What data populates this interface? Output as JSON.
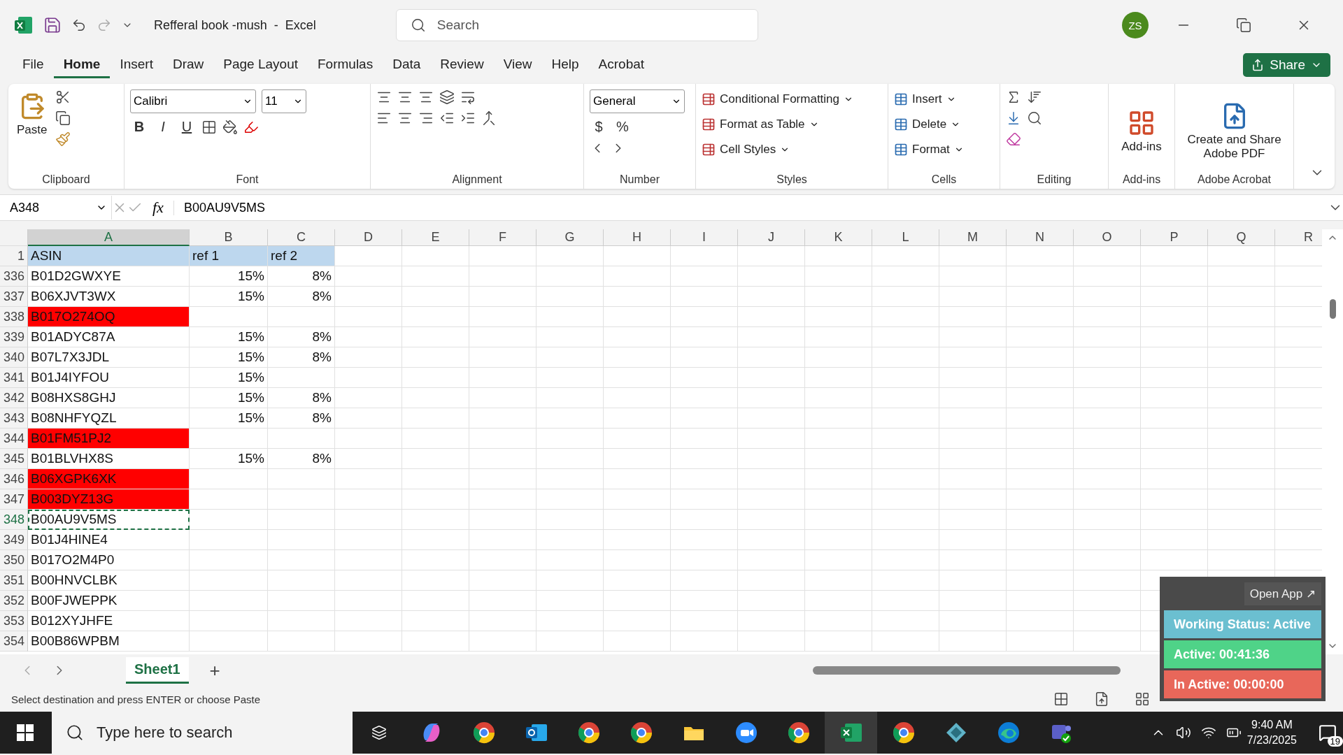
{
  "window": {
    "title": "Refferal book -mush  -  Excel",
    "search_placeholder": "Search",
    "user_initials": "ZS"
  },
  "ribbon_tabs": [
    {
      "label": "File",
      "selected": false
    },
    {
      "label": "Home",
      "selected": true
    },
    {
      "label": "Insert",
      "selected": false
    },
    {
      "label": "Draw",
      "selected": false
    },
    {
      "label": "Page Layout",
      "selected": false
    },
    {
      "label": "Formulas",
      "selected": false
    },
    {
      "label": "Data",
      "selected": false
    },
    {
      "label": "Review",
      "selected": false
    },
    {
      "label": "View",
      "selected": false
    },
    {
      "label": "Help",
      "selected": false
    },
    {
      "label": "Acrobat",
      "selected": false
    }
  ],
  "share_button": "Share",
  "ribbon": {
    "clipboard": {
      "paste": "Paste",
      "group": "Clipboard"
    },
    "font": {
      "name": "Calibri",
      "size": "11",
      "bold": "B",
      "italic": "I",
      "underline": "U",
      "group": "Font"
    },
    "alignment": {
      "group": "Alignment"
    },
    "number": {
      "format": "General",
      "currency": "$",
      "percent": "%",
      "group": "Number"
    },
    "styles": {
      "items": [
        "Conditional Formatting",
        "Format as Table",
        "Cell Styles"
      ],
      "group": "Styles"
    },
    "cells": {
      "items": [
        "Insert",
        "Delete",
        "Format"
      ],
      "group": "Cells"
    },
    "editing": {
      "group": "Editing"
    },
    "addins": {
      "label": "Add-ins",
      "group": "Add-ins"
    },
    "acrobat": {
      "label": "Create and Share Adobe PDF",
      "group": "Adobe Acrobat"
    }
  },
  "formula_bar": {
    "name_box": "A348",
    "fx": "fx",
    "value": "B00AU9V5MS"
  },
  "sheet": {
    "columns": [
      {
        "label": "A",
        "selected": true
      },
      {
        "label": "B",
        "selected": false
      },
      {
        "label": "C",
        "selected": false
      },
      {
        "label": "D",
        "selected": false
      },
      {
        "label": "E",
        "selected": false
      },
      {
        "label": "F",
        "selected": false
      },
      {
        "label": "G",
        "selected": false
      },
      {
        "label": "H",
        "selected": false
      },
      {
        "label": "I",
        "selected": false
      },
      {
        "label": "J",
        "selected": false
      },
      {
        "label": "K",
        "selected": false
      },
      {
        "label": "L",
        "selected": false
      },
      {
        "label": "M",
        "selected": false
      },
      {
        "label": "N",
        "selected": false
      },
      {
        "label": "O",
        "selected": false
      },
      {
        "label": "P",
        "selected": false
      },
      {
        "label": "Q",
        "selected": false
      },
      {
        "label": "R",
        "selected": false
      }
    ],
    "rows": [
      {
        "number": "1",
        "kind": "header",
        "cells": [
          "ASIN",
          "ref 1",
          "ref 2"
        ],
        "highlight": false,
        "selected": false
      },
      {
        "number": "336",
        "kind": "data",
        "cells": [
          "B01D2GWXYE",
          "15%",
          "8%"
        ],
        "highlight": false,
        "selected": false
      },
      {
        "number": "337",
        "kind": "data",
        "cells": [
          "B06XJVT3WX",
          "15%",
          "8%"
        ],
        "highlight": false,
        "selected": false
      },
      {
        "number": "338",
        "kind": "data",
        "cells": [
          "B017O274OQ"
        ],
        "highlight": true,
        "selected": false
      },
      {
        "number": "339",
        "kind": "data",
        "cells": [
          "B01ADYC87A",
          "15%",
          "8%"
        ],
        "highlight": false,
        "selected": false
      },
      {
        "number": "340",
        "kind": "data",
        "cells": [
          "B07L7X3JDL",
          "15%",
          "8%"
        ],
        "highlight": false,
        "selected": false
      },
      {
        "number": "341",
        "kind": "data",
        "cells": [
          "B01J4IYFOU",
          "15%"
        ],
        "highlight": false,
        "selected": false
      },
      {
        "number": "342",
        "kind": "data",
        "cells": [
          "B08HXS8GHJ",
          "15%",
          "8%"
        ],
        "highlight": false,
        "selected": false
      },
      {
        "number": "343",
        "kind": "data",
        "cells": [
          "B08NHFYQZL",
          "15%",
          "8%"
        ],
        "highlight": false,
        "selected": false
      },
      {
        "number": "344",
        "kind": "data",
        "cells": [
          "B01FM51PJ2"
        ],
        "highlight": true,
        "selected": false
      },
      {
        "number": "345",
        "kind": "data",
        "cells": [
          "B01BLVHX8S",
          "15%",
          "8%"
        ],
        "highlight": false,
        "selected": false
      },
      {
        "number": "346",
        "kind": "data",
        "cells": [
          "B06XGPK6XK"
        ],
        "highlight": true,
        "selected": false
      },
      {
        "number": "347",
        "kind": "data",
        "cells": [
          "B003DYZ13G"
        ],
        "highlight": true,
        "selected": false
      },
      {
        "number": "348",
        "kind": "data",
        "cells": [
          "B00AU9V5MS"
        ],
        "highlight": false,
        "selected": true
      },
      {
        "number": "349",
        "kind": "data",
        "cells": [
          "B01J4HINE4"
        ],
        "highlight": false,
        "selected": false
      },
      {
        "number": "350",
        "kind": "data",
        "cells": [
          "B017O2M4P0"
        ],
        "highlight": false,
        "selected": false
      },
      {
        "number": "351",
        "kind": "data",
        "cells": [
          "B00HNVCLBK"
        ],
        "highlight": false,
        "selected": false
      },
      {
        "number": "352",
        "kind": "data",
        "cells": [
          "B00FJWEPPK"
        ],
        "highlight": false,
        "selected": false
      },
      {
        "number": "353",
        "kind": "data",
        "cells": [
          "B012XYJHFE"
        ],
        "highlight": false,
        "selected": false
      },
      {
        "number": "354",
        "kind": "data",
        "cells": [
          "B00B86WPBM"
        ],
        "highlight": false,
        "selected": false
      }
    ]
  },
  "sheet_tabs": [
    {
      "label": "Sheet1",
      "selected": true
    }
  ],
  "add_sheet": "+",
  "status_bar": {
    "message": "Select destination and press ENTER or choose Paste"
  },
  "tracker_widget": {
    "open_app": "Open App ↗",
    "bars": [
      {
        "label": "Working Status: Active",
        "color": "#6bbfd0"
      },
      {
        "label": "Active: 00:41:36",
        "color": "#4fd388"
      },
      {
        "label": "In Active: 00:00:00",
        "color": "#e8675a"
      }
    ]
  },
  "taskbar": {
    "search_placeholder": "Type here to search",
    "apps": [
      {
        "kind": "copilot",
        "active": false
      },
      {
        "kind": "chrome",
        "active": false
      },
      {
        "kind": "outlook",
        "active": false
      },
      {
        "kind": "chrome",
        "active": false
      },
      {
        "kind": "chrome",
        "active": false
      },
      {
        "kind": "folder",
        "active": false
      },
      {
        "kind": "zoom",
        "active": false
      },
      {
        "kind": "chrome",
        "active": false
      },
      {
        "kind": "excel",
        "active": true
      },
      {
        "kind": "chrome",
        "active": false
      },
      {
        "kind": "diamond",
        "active": false
      },
      {
        "kind": "edge",
        "active": false
      },
      {
        "kind": "teams",
        "active": false
      }
    ],
    "time": "9:40 AM",
    "date": "7/23/2025",
    "notifications": "19"
  }
}
